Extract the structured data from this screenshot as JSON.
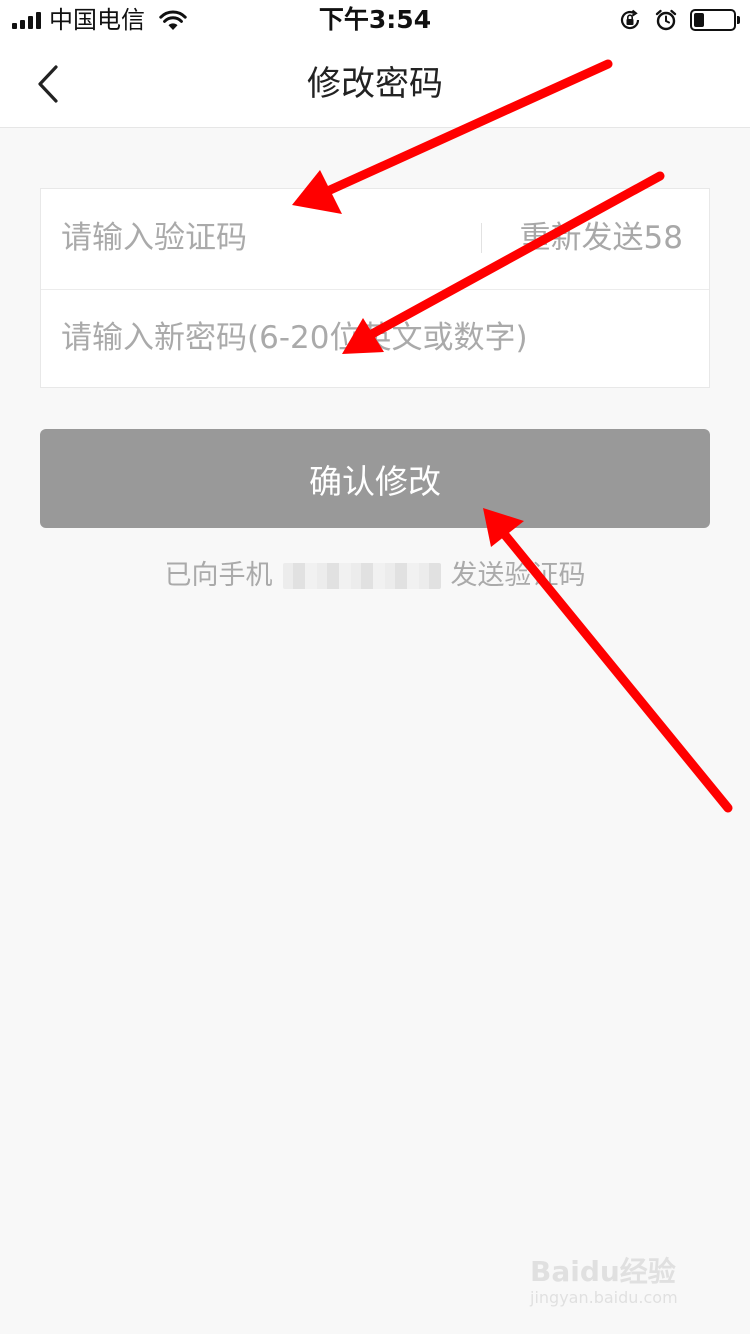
{
  "status_bar": {
    "carrier": "中国电信",
    "time": "下午3:54",
    "battery_level": 0.25,
    "icons": [
      "signal-icon",
      "wifi-icon",
      "orientation-lock-icon",
      "alarm-icon",
      "battery-icon"
    ]
  },
  "nav": {
    "back_icon": "chevron-left-icon",
    "title": "修改密码"
  },
  "form": {
    "code_placeholder": "请输入验证码",
    "resend_label": "重新发送58",
    "password_placeholder": "请输入新密码(6-20位英文或数字)"
  },
  "confirm_button": {
    "label": "确认修改",
    "background": "#999999"
  },
  "hint": {
    "prefix": "已向手机",
    "suffix": "发送验证码"
  },
  "annotation": {
    "arrow_color": "#ff0000",
    "arrow_count": 3
  },
  "watermark": {
    "logo": "Baidu经验",
    "url": "jingyan.baidu.com"
  }
}
